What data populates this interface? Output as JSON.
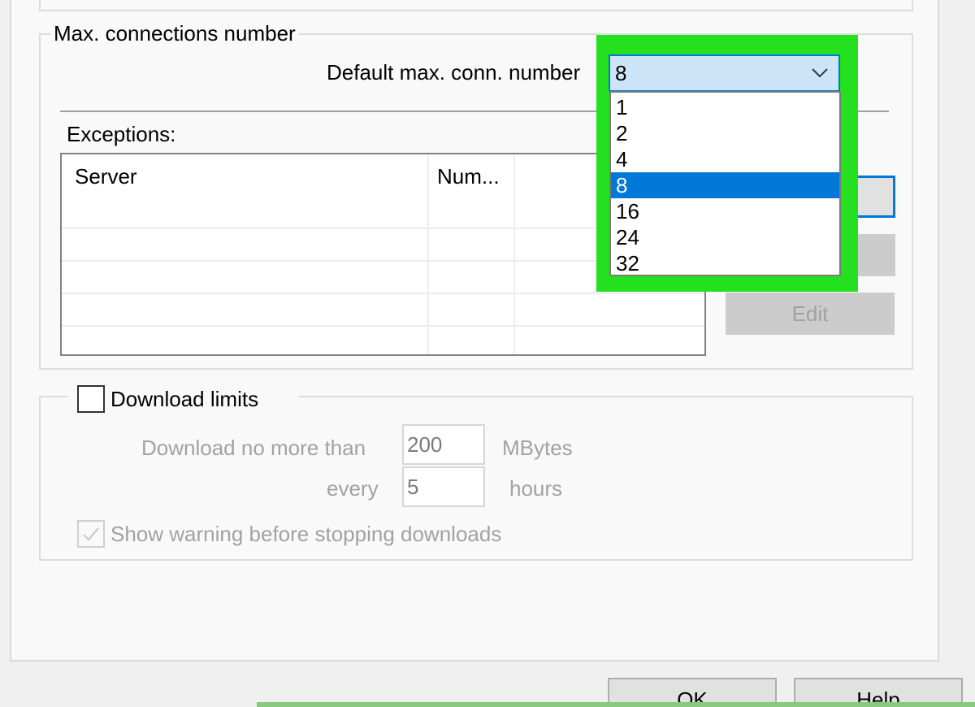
{
  "max_connections": {
    "group_title": "Max. connections number",
    "default_label": "Default max. conn. number",
    "default_value": "8",
    "dropdown_options": [
      "1",
      "2",
      "4",
      "8",
      "16",
      "24",
      "32"
    ],
    "selected_index": 3,
    "exceptions_label": "Exceptions:",
    "columns": [
      "Server",
      "Num..."
    ],
    "edit_button": "Edit"
  },
  "download_limits": {
    "checkbox_label": "Download limits",
    "checked": false,
    "no_more_than_label": "Download no more than",
    "mbytes_value": "200",
    "mbytes_unit": "MBytes",
    "every_label": "every",
    "hours_value": "5",
    "hours_unit": "hours",
    "warning_label": "Show warning before stopping downloads",
    "warning_checked": true
  },
  "dialog_buttons": {
    "ok": "OK",
    "help": "Help"
  },
  "colors": {
    "highlight": "#25e01e",
    "selection": "#0078d7",
    "combo_bg": "#cce4f7"
  }
}
